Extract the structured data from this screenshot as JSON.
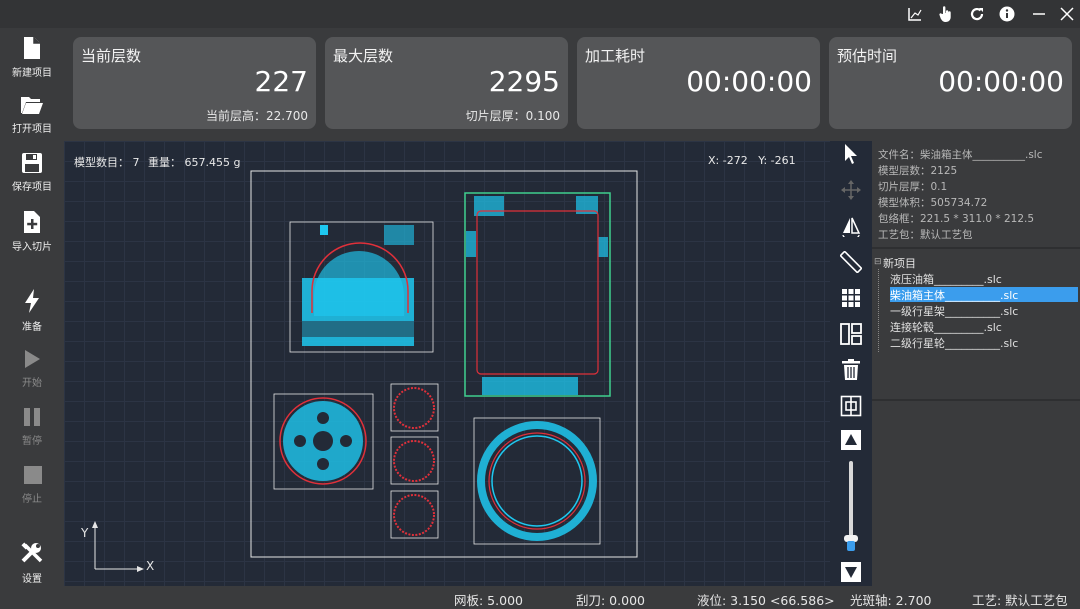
{
  "sidebar": {
    "new_project": "新建项目",
    "open_project": "打开项目",
    "save_project": "保存项目",
    "import_slice": "导入切片",
    "prepare": "准备",
    "start": "开始",
    "pause": "暂停",
    "stop": "停止",
    "settings": "设置"
  },
  "cards": {
    "current_layer": {
      "title": "当前层数",
      "value": "227",
      "sub": "当前层高：22.700"
    },
    "max_layer": {
      "title": "最大层数",
      "value": "2295",
      "sub": "切片层厚：0.100"
    },
    "process_time": {
      "title": "加工耗时",
      "value": "00:00:00"
    },
    "estimated_time": {
      "title": "预估时间",
      "value": "00:00:00"
    }
  },
  "viewport": {
    "model_count": "模型数目： 7",
    "weight": "重量： 657.455 g",
    "coords": "X: -272   Y: -261",
    "axis_x": "X",
    "axis_y": "Y"
  },
  "file_info": {
    "filename": "文件名：柴油箱主体__________.slc",
    "layers": "模型层数：2125",
    "thickness": "切片层厚：0.1",
    "volume": "模型体积：505734.72",
    "bbox": "包络框：221.5 * 311.0 * 212.5",
    "process": "工艺包：默认工艺包"
  },
  "tree": {
    "root": "新项目",
    "items": [
      "液压油箱_________.slc",
      "柴油箱主体__________.slc",
      "一级行星架__________.slc",
      "连接轮毂_________.slc",
      "二级行星轮__________.slc"
    ]
  },
  "status": {
    "plate": "网板: 5.000",
    "scraper": "刮刀: 0.000",
    "level": "液位: 3.150 <66.586>",
    "galvo": "光斑轴: 2.700",
    "process": "工艺: 默认工艺包"
  },
  "colors": {
    "accent": "#3b9ded",
    "slice_fill": "#1ec8f0",
    "contour": "#e0303a",
    "selected_box": "#3fcf8e"
  },
  "zoom_slider_level": 0.08
}
